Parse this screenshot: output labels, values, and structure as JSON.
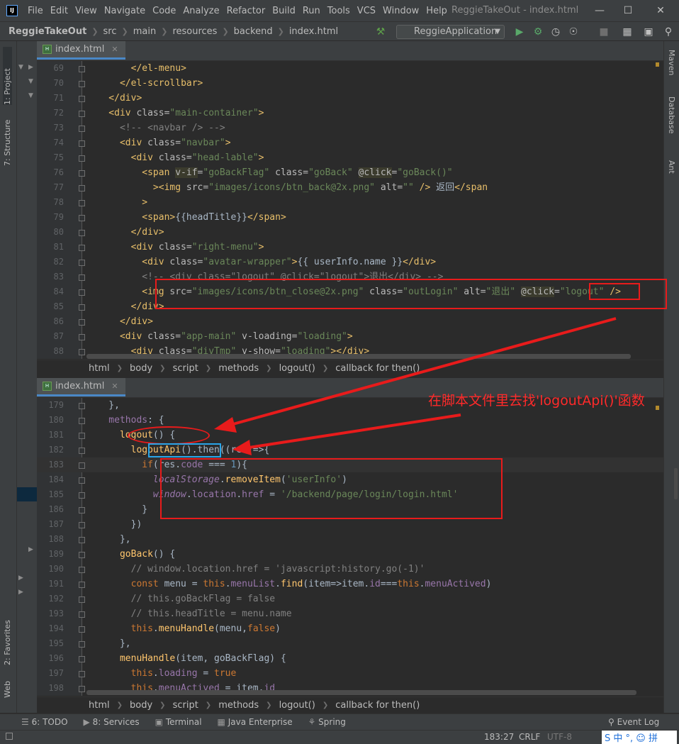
{
  "titlebar": {
    "menus": [
      "File",
      "Edit",
      "View",
      "Navigate",
      "Code",
      "Analyze",
      "Refactor",
      "Build",
      "Run",
      "Tools",
      "VCS",
      "Window",
      "Help"
    ],
    "window_title": "ReggieTakeOut - index.html"
  },
  "breadcrumbs": [
    "ReggieTakeOut",
    "src",
    "main",
    "resources",
    "backend",
    "index.html"
  ],
  "run_config": "ReggieApplication",
  "left_tabs": {
    "project": "1: Project",
    "structure": "7: Structure",
    "favorites": "2: Favorites",
    "web": "Web"
  },
  "right_tabs": {
    "maven": "Maven",
    "database": "Database",
    "ant": "Ant"
  },
  "tab_label": "index.html",
  "editor_top": {
    "lines": [
      {
        "n": "69",
        "segs": [
          {
            "t": "        </",
            "c": "tg"
          },
          {
            "t": "el-menu",
            "c": "tg"
          },
          {
            "t": ">",
            "c": "tg"
          }
        ]
      },
      {
        "n": "70",
        "segs": [
          {
            "t": "      </",
            "c": "tg"
          },
          {
            "t": "el-scrollbar",
            "c": "tg"
          },
          {
            "t": ">",
            "c": "tg"
          }
        ]
      },
      {
        "n": "71",
        "segs": [
          {
            "t": "    </div>",
            "c": "tg"
          }
        ]
      },
      {
        "n": "72",
        "segs": [
          {
            "t": "    <div ",
            "c": "tg"
          },
          {
            "t": "class",
            "c": "at"
          },
          {
            "t": "=",
            "c": "at"
          },
          {
            "t": "\"main-container\"",
            "c": "st"
          },
          {
            "t": ">",
            "c": "tg"
          }
        ]
      },
      {
        "n": "73",
        "segs": [
          {
            "t": "      <!-- <navbar /> -->",
            "c": "cm"
          }
        ]
      },
      {
        "n": "74",
        "segs": [
          {
            "t": "      <div ",
            "c": "tg"
          },
          {
            "t": "class",
            "c": "at"
          },
          {
            "t": "=",
            "c": "at"
          },
          {
            "t": "\"navbar\"",
            "c": "st"
          },
          {
            "t": ">",
            "c": "tg"
          }
        ]
      },
      {
        "n": "75",
        "segs": [
          {
            "t": "        <div ",
            "c": "tg"
          },
          {
            "t": "class",
            "c": "at"
          },
          {
            "t": "=",
            "c": "at"
          },
          {
            "t": "\"head-lable\"",
            "c": "st"
          },
          {
            "t": ">",
            "c": "tg"
          }
        ]
      },
      {
        "n": "76",
        "segs": [
          {
            "t": "          <span ",
            "c": "tg"
          },
          {
            "t": "v-if",
            "c": "at bg"
          },
          {
            "t": "=",
            "c": "at"
          },
          {
            "t": "\"goBackFlag\"",
            "c": "st"
          },
          {
            "t": " class",
            "c": "at"
          },
          {
            "t": "=",
            "c": "at"
          },
          {
            "t": "\"goBack\" ",
            "c": "st"
          },
          {
            "t": "@click",
            "c": "at bg"
          },
          {
            "t": "=",
            "c": "at"
          },
          {
            "t": "\"goBack()\"",
            "c": "st"
          }
        ]
      },
      {
        "n": "77",
        "segs": [
          {
            "t": "            ><img ",
            "c": "tg"
          },
          {
            "t": "src",
            "c": "at"
          },
          {
            "t": "=",
            "c": "at"
          },
          {
            "t": "\"images/icons/btn_back@2x.png\" ",
            "c": "st"
          },
          {
            "t": "alt",
            "c": "at"
          },
          {
            "t": "=",
            "c": "at"
          },
          {
            "t": "\"\" ",
            "c": "st"
          },
          {
            "t": "/> ",
            "c": "tg"
          },
          {
            "t": "返回",
            "c": ""
          },
          {
            "t": "</span",
            "c": "tg"
          }
        ]
      },
      {
        "n": "78",
        "segs": [
          {
            "t": "          >",
            "c": "tg"
          }
        ]
      },
      {
        "n": "79",
        "segs": [
          {
            "t": "          <span>",
            "c": "tg"
          },
          {
            "t": "{{headTitle}}",
            "c": ""
          },
          {
            "t": "</span>",
            "c": "tg"
          }
        ]
      },
      {
        "n": "80",
        "segs": [
          {
            "t": "        </div>",
            "c": "tg"
          }
        ]
      },
      {
        "n": "81",
        "segs": [
          {
            "t": "        <div ",
            "c": "tg"
          },
          {
            "t": "class",
            "c": "at"
          },
          {
            "t": "=",
            "c": "at"
          },
          {
            "t": "\"right-menu\"",
            "c": "st"
          },
          {
            "t": ">",
            "c": "tg"
          }
        ]
      },
      {
        "n": "82",
        "segs": [
          {
            "t": "          <div ",
            "c": "tg"
          },
          {
            "t": "class",
            "c": "at"
          },
          {
            "t": "=",
            "c": "at"
          },
          {
            "t": "\"avatar-wrapper\"",
            "c": "st"
          },
          {
            "t": ">",
            "c": "tg"
          },
          {
            "t": "{{ userInfo.name }}",
            "c": ""
          },
          {
            "t": "</div>",
            "c": "tg"
          }
        ]
      },
      {
        "n": "83",
        "segs": [
          {
            "t": "          <!-- <div class=\"logout\" @click=\"logout\">退出</div> -->",
            "c": "cm"
          }
        ]
      },
      {
        "n": "84",
        "segs": [
          {
            "t": "          <img ",
            "c": "tg"
          },
          {
            "t": "src",
            "c": "at"
          },
          {
            "t": "=",
            "c": "at"
          },
          {
            "t": "\"images/icons/btn_close@2x.png\" ",
            "c": "st"
          },
          {
            "t": "class",
            "c": "at"
          },
          {
            "t": "=",
            "c": "at"
          },
          {
            "t": "\"outLogin\" ",
            "c": "st"
          },
          {
            "t": "alt",
            "c": "at"
          },
          {
            "t": "=",
            "c": "at"
          },
          {
            "t": "\"退出\" ",
            "c": "st"
          },
          {
            "t": "@click",
            "c": "at bg"
          },
          {
            "t": "=",
            "c": "at"
          },
          {
            "t": "\"logout\"",
            "c": "st"
          },
          {
            "t": " />",
            "c": "tg"
          }
        ]
      },
      {
        "n": "85",
        "segs": [
          {
            "t": "        </div>",
            "c": "tg"
          }
        ]
      },
      {
        "n": "86",
        "segs": [
          {
            "t": "      </div>",
            "c": "tg"
          }
        ]
      },
      {
        "n": "87",
        "segs": [
          {
            "t": "      <div ",
            "c": "tg"
          },
          {
            "t": "class",
            "c": "at"
          },
          {
            "t": "=",
            "c": "at"
          },
          {
            "t": "\"app-main\" ",
            "c": "st"
          },
          {
            "t": "v-loading",
            "c": "at"
          },
          {
            "t": "=",
            "c": "at"
          },
          {
            "t": "\"loading\"",
            "c": "st"
          },
          {
            "t": ">",
            "c": "tg"
          }
        ]
      },
      {
        "n": "88",
        "segs": [
          {
            "t": "        <div ",
            "c": "tg"
          },
          {
            "t": "class",
            "c": "at"
          },
          {
            "t": "=",
            "c": "at"
          },
          {
            "t": "\"divTmp\" ",
            "c": "st"
          },
          {
            "t": "v-show",
            "c": "at"
          },
          {
            "t": "=",
            "c": "at"
          },
          {
            "t": "\"loading\"",
            "c": "st"
          },
          {
            "t": "></div>",
            "c": "tg"
          }
        ]
      }
    ]
  },
  "editor_bottom": {
    "lines": [
      {
        "n": "179",
        "segs": [
          {
            "t": "    },",
            "c": ""
          }
        ]
      },
      {
        "n": "180",
        "segs": [
          {
            "t": "    methods",
            "c": "pr"
          },
          {
            "t": ": {",
            "c": ""
          }
        ]
      },
      {
        "n": "181",
        "segs": [
          {
            "t": "      logout",
            "c": "fn"
          },
          {
            "t": "() {",
            "c": ""
          }
        ]
      },
      {
        "n": "182",
        "segs": [
          {
            "t": "        logoutApi",
            "c": "fn"
          },
          {
            "t": "().then((res)=>{",
            "c": ""
          }
        ]
      },
      {
        "n": "183",
        "segs": [
          {
            "t": "          if",
            "c": "kw"
          },
          {
            "t": "(res.",
            "c": ""
          },
          {
            "t": "code",
            "c": "pr"
          },
          {
            "t": " === ",
            "c": ""
          },
          {
            "t": "1",
            "c": "nu"
          },
          {
            "t": "){",
            "c": ""
          }
        ]
      },
      {
        "n": "184",
        "segs": [
          {
            "t": "            localStorage",
            "c": "pr it"
          },
          {
            "t": ".",
            "c": ""
          },
          {
            "t": "removeItem",
            "c": "fn"
          },
          {
            "t": "(",
            "c": ""
          },
          {
            "t": "'userInfo'",
            "c": "st"
          },
          {
            "t": ")",
            "c": ""
          }
        ]
      },
      {
        "n": "185",
        "segs": [
          {
            "t": "            window",
            "c": "pr it"
          },
          {
            "t": ".",
            "c": ""
          },
          {
            "t": "location",
            "c": "pr"
          },
          {
            "t": ".",
            "c": ""
          },
          {
            "t": "href",
            "c": "pr"
          },
          {
            "t": " = ",
            "c": ""
          },
          {
            "t": "'/backend/page/login/login.html'",
            "c": "st"
          }
        ]
      },
      {
        "n": "186",
        "segs": [
          {
            "t": "          }",
            "c": ""
          }
        ]
      },
      {
        "n": "187",
        "segs": [
          {
            "t": "        })",
            "c": ""
          }
        ]
      },
      {
        "n": "188",
        "segs": [
          {
            "t": "      },",
            "c": ""
          }
        ]
      },
      {
        "n": "189",
        "segs": [
          {
            "t": "      goBack",
            "c": "fn"
          },
          {
            "t": "() {",
            "c": ""
          }
        ]
      },
      {
        "n": "190",
        "segs": [
          {
            "t": "        // window.location.href = 'javascript:history.go(-1)'",
            "c": "cm"
          }
        ]
      },
      {
        "n": "191",
        "segs": [
          {
            "t": "        const ",
            "c": "kw"
          },
          {
            "t": "menu = ",
            "c": ""
          },
          {
            "t": "this",
            "c": "kw"
          },
          {
            "t": ".",
            "c": ""
          },
          {
            "t": "menuList",
            "c": "pr"
          },
          {
            "t": ".",
            "c": ""
          },
          {
            "t": "find",
            "c": "fn"
          },
          {
            "t": "(item=>item.",
            "c": ""
          },
          {
            "t": "id",
            "c": "pr"
          },
          {
            "t": "===",
            "c": ""
          },
          {
            "t": "this",
            "c": "kw"
          },
          {
            "t": ".",
            "c": ""
          },
          {
            "t": "menuActived",
            "c": "pr"
          },
          {
            "t": ")",
            "c": ""
          }
        ]
      },
      {
        "n": "192",
        "segs": [
          {
            "t": "        // this.goBackFlag = false",
            "c": "cm"
          }
        ]
      },
      {
        "n": "193",
        "segs": [
          {
            "t": "        // this.headTitle = menu.name",
            "c": "cm"
          }
        ]
      },
      {
        "n": "194",
        "segs": [
          {
            "t": "        this",
            "c": "kw"
          },
          {
            "t": ".",
            "c": ""
          },
          {
            "t": "menuHandle",
            "c": "fn"
          },
          {
            "t": "(menu,",
            "c": ""
          },
          {
            "t": "false",
            "c": "kw"
          },
          {
            "t": ")",
            "c": ""
          }
        ]
      },
      {
        "n": "195",
        "segs": [
          {
            "t": "      },",
            "c": ""
          }
        ]
      },
      {
        "n": "196",
        "segs": [
          {
            "t": "      menuHandle",
            "c": "fn"
          },
          {
            "t": "(item, goBackFlag) {",
            "c": ""
          }
        ]
      },
      {
        "n": "197",
        "segs": [
          {
            "t": "        this",
            "c": "kw"
          },
          {
            "t": ".",
            "c": ""
          },
          {
            "t": "loading",
            "c": "pr"
          },
          {
            "t": " = ",
            "c": ""
          },
          {
            "t": "true",
            "c": "kw"
          }
        ]
      },
      {
        "n": "198",
        "segs": [
          {
            "t": "        this",
            "c": "kw"
          },
          {
            "t": ".",
            "c": ""
          },
          {
            "t": "menuActived",
            "c": "pr"
          },
          {
            "t": " = item.",
            "c": ""
          },
          {
            "t": "id",
            "c": "pr"
          }
        ]
      }
    ]
  },
  "editor_breadcrumbs": [
    "html",
    "body",
    "script",
    "methods",
    "logout()",
    "callback for then()"
  ],
  "annotation_text": "在脚本文件里去找'logoutApi()'函数",
  "bottom_tools": [
    "6: TODO",
    "8: Services",
    "Terminal",
    "Java Enterprise",
    "Spring"
  ],
  "event_log": "Event Log",
  "status": {
    "position": "183:27",
    "line_sep": "CRLF",
    "encoding": "UTF-8"
  },
  "ime": "S 中 °, ☺ 拼"
}
